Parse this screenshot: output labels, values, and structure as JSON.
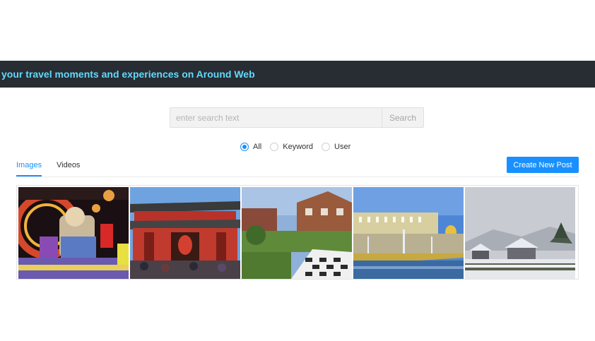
{
  "header": {
    "title": "your travel moments and experiences on Around Web"
  },
  "search": {
    "placeholder": "enter search text",
    "button_label": "Search"
  },
  "filter": {
    "options": [
      {
        "label": "All",
        "checked": true
      },
      {
        "label": "Keyword",
        "checked": false
      },
      {
        "label": "User",
        "checked": false
      }
    ]
  },
  "tabs": [
    {
      "label": "Images",
      "active": true
    },
    {
      "label": "Videos",
      "active": false
    }
  ],
  "actions": {
    "create_post_label": "Create New Post"
  },
  "colors": {
    "accent": "#1890ff",
    "header_bg": "#282c33",
    "header_text": "#61dafb"
  },
  "gallery": {
    "images": [
      {
        "icon": "lantern-festival-photo"
      },
      {
        "icon": "temple-gate-photo"
      },
      {
        "icon": "chessboard-lawn-photo"
      },
      {
        "icon": "palace-fountain-photo"
      },
      {
        "icon": "snowy-village-photo"
      }
    ]
  }
}
